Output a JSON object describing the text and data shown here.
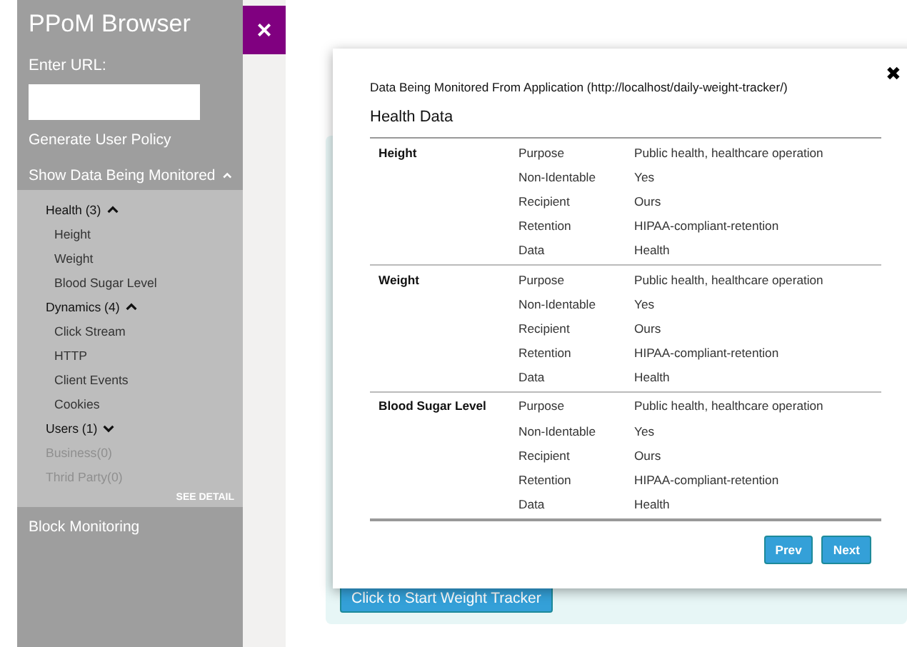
{
  "sidebar": {
    "title": "PPoM Browser",
    "url_label": "Enter URL:",
    "url_field": {
      "kind": "text"
    },
    "generate_link": "Generate User Policy",
    "monitor_section": {
      "label": "Show Data Being Monitored",
      "expanded": true,
      "categories": [
        {
          "label": "Health (3)",
          "expanded": true,
          "disabled": false,
          "children": [
            {
              "label": "Height"
            },
            {
              "label": "Weight"
            },
            {
              "label": "Blood Sugar Level"
            }
          ]
        },
        {
          "label": "Dynamics (4)",
          "expanded": true,
          "disabled": false,
          "children": [
            {
              "label": "Click Stream"
            },
            {
              "label": "HTTP"
            },
            {
              "label": "Client Events"
            },
            {
              "label": "Cookies"
            }
          ]
        },
        {
          "label": "Users (1)",
          "expanded": false,
          "disabled": false
        },
        {
          "label": "Business(0)",
          "expanded": false,
          "disabled": true
        },
        {
          "label": "Thrid Party(0)",
          "expanded": false,
          "disabled": true
        }
      ],
      "detail_link": "SEE DETAIL"
    },
    "block_link": "Block Monitoring"
  },
  "close_sidebar": "×",
  "page": {
    "start_button": "Click to Start Weight Tracker"
  },
  "modal": {
    "title": "Data Being Monitored From Application (http://localhost/daily-weight-tracker/)",
    "close": "✖",
    "heading": "Health Data",
    "groups": [
      {
        "name": "Height",
        "fields": [
          {
            "label": "Purpose",
            "value": "Public health, healthcare operation"
          },
          {
            "label": "Non-Identable",
            "value": "Yes"
          },
          {
            "label": "Recipient",
            "value": "Ours"
          },
          {
            "label": "Retention",
            "value": "HIPAA-compliant-retention"
          },
          {
            "label": "Data",
            "value": "Health"
          }
        ]
      },
      {
        "name": "Weight",
        "fields": [
          {
            "label": "Purpose",
            "value": "Public health, healthcare operation"
          },
          {
            "label": "Non-Identable",
            "value": "Yes"
          },
          {
            "label": "Recipient",
            "value": "Ours"
          },
          {
            "label": "Retention",
            "value": "HIPAA-compliant-retention"
          },
          {
            "label": "Data",
            "value": "Health"
          }
        ]
      },
      {
        "name": "Blood Sugar Level",
        "fields": [
          {
            "label": "Purpose",
            "value": "Public health, healthcare operation"
          },
          {
            "label": "Non-Identable",
            "value": "Yes"
          },
          {
            "label": "Recipient",
            "value": "Ours"
          },
          {
            "label": "Retention",
            "value": "HIPAA-compliant-retention"
          },
          {
            "label": "Data",
            "value": "Health"
          }
        ]
      }
    ],
    "buttons": [
      "Prev",
      "Next"
    ]
  }
}
